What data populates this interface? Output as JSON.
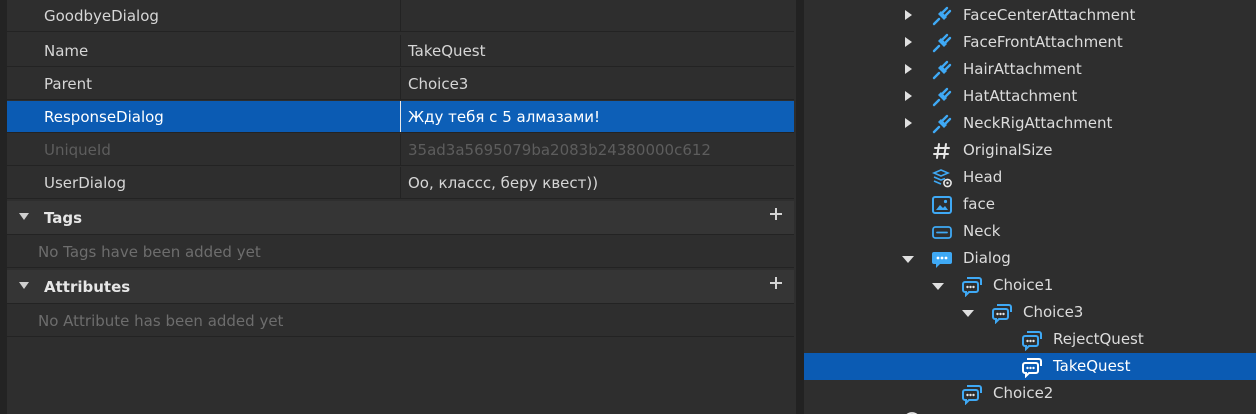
{
  "properties": {
    "rows": [
      {
        "name": "GoodbyeDialog",
        "value": ""
      },
      {
        "name": "Name",
        "value": "TakeQuest"
      },
      {
        "name": "Parent",
        "value": "Choice3"
      },
      {
        "name": "ResponseDialog",
        "value": "Жду тебя с 5 алмазами!"
      },
      {
        "name": "UniqueId",
        "value": "35ad3a5695079ba2083b24380000c612"
      },
      {
        "name": "UserDialog",
        "value": "Оо, классс, беру квест))"
      }
    ],
    "tags": {
      "title": "Tags",
      "empty_text": "No Tags have been added yet"
    },
    "attributes": {
      "title": "Attributes",
      "empty_text": "No Attribute has been added yet"
    }
  },
  "explorer": {
    "items": [
      {
        "label": "FaceCenterAttachment",
        "icon": "attachment-icon"
      },
      {
        "label": "FaceFrontAttachment",
        "icon": "attachment-icon"
      },
      {
        "label": "HairAttachment",
        "icon": "attachment-icon"
      },
      {
        "label": "HatAttachment",
        "icon": "attachment-icon"
      },
      {
        "label": "NeckRigAttachment",
        "icon": "attachment-icon"
      },
      {
        "label": "OriginalSize",
        "icon": "number-value-icon"
      },
      {
        "label": "Head",
        "icon": "special-mesh-icon"
      },
      {
        "label": "face",
        "icon": "decal-icon"
      },
      {
        "label": "Neck",
        "icon": "motor6d-icon"
      },
      {
        "label": "Dialog",
        "icon": "dialog-icon"
      },
      {
        "label": "Choice1",
        "icon": "dialog-choice-icon"
      },
      {
        "label": "Choice3",
        "icon": "dialog-choice-icon"
      },
      {
        "label": "RejectQuest",
        "icon": "dialog-choice-icon"
      },
      {
        "label": "TakeQuest",
        "icon": "dialog-choice-icon"
      },
      {
        "label": "Choice2",
        "icon": "dialog-choice-icon"
      }
    ]
  },
  "colors": {
    "selection": "#0b5bb3",
    "icon_blue": "#3fa9f5",
    "panel_bg": "#2e2e2e"
  }
}
